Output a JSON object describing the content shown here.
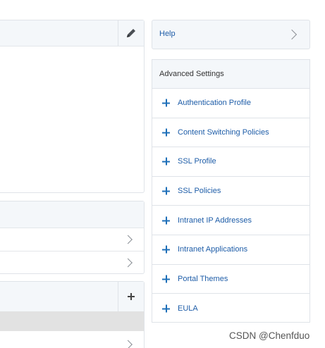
{
  "right_panel": {
    "help": {
      "label": "Help",
      "icon": "chevron-right-icon"
    },
    "advanced": {
      "title": "Advanced Settings",
      "items": [
        {
          "label": "Authentication Profile",
          "icon": "plus-icon"
        },
        {
          "label": "Content Switching Policies",
          "icon": "plus-icon"
        },
        {
          "label": "SSL Profile",
          "icon": "plus-icon"
        },
        {
          "label": "SSL Policies",
          "icon": "plus-icon"
        },
        {
          "label": "Intranet IP Addresses",
          "icon": "plus-icon"
        },
        {
          "label": "Intranet Applications",
          "icon": "plus-icon"
        },
        {
          "label": "Portal Themes",
          "icon": "plus-icon"
        },
        {
          "label": "EULA",
          "icon": "plus-icon"
        }
      ]
    }
  },
  "left_panels": {
    "basic": {
      "action_icon": "pencil-icon"
    },
    "bindings": {
      "row_icon": "chevron-right-icon"
    },
    "policies": {
      "action_icon": "plus-icon",
      "row_icon": "chevron-right-icon"
    }
  },
  "colors": {
    "link": "#1e5da8",
    "accent": "#1e6fb8",
    "header_bg": "#f4f7fa",
    "border": "#dfe3e8",
    "selected_row": "#e2e2e2"
  },
  "watermark": "CSDN @Chenfduo"
}
